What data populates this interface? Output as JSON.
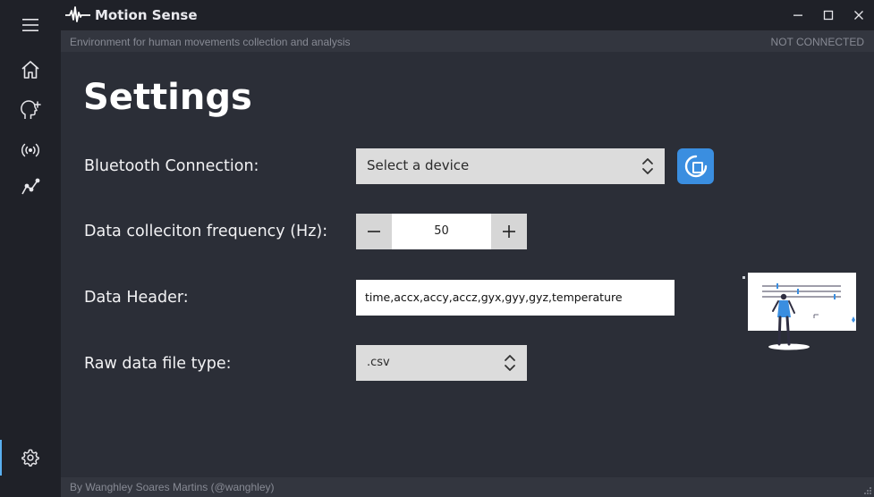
{
  "app": {
    "title": "Motion Sense",
    "subtitle": "Environment for human movements collection and analysis",
    "connection_status": "NOT CONNECTED",
    "footer": "By Wanghley Soares Martins (@wanghley)"
  },
  "sidebar": {
    "items": [
      {
        "name": "menu",
        "icon": "hamburger-icon"
      },
      {
        "name": "home",
        "icon": "home-icon"
      },
      {
        "name": "add-profile",
        "icon": "head-plus-icon"
      },
      {
        "name": "broadcast",
        "icon": "broadcast-icon"
      },
      {
        "name": "analytics",
        "icon": "line-chart-icon"
      },
      {
        "name": "settings",
        "icon": "gear-icon",
        "active": true
      }
    ]
  },
  "window_controls": [
    "minimize",
    "maximize",
    "close"
  ],
  "page": {
    "title": "Settings",
    "rows": {
      "bluetooth": {
        "label": "Bluetooth Connection:",
        "selected": "Select a device"
      },
      "frequency": {
        "label": "Data colleciton frequency (Hz):",
        "value": "50",
        "minus": "−",
        "plus": "+"
      },
      "header": {
        "label": "Data Header:",
        "value": "time,accx,accy,accz,gyx,gyy,gyz,temperature"
      },
      "filetype": {
        "label": "Raw data file type:",
        "selected": ".csv"
      }
    }
  },
  "colors": {
    "background": "#2b2e37",
    "sidebar": "#1f2128",
    "accent": "#3a8ee0",
    "muted_text": "#878a94"
  }
}
